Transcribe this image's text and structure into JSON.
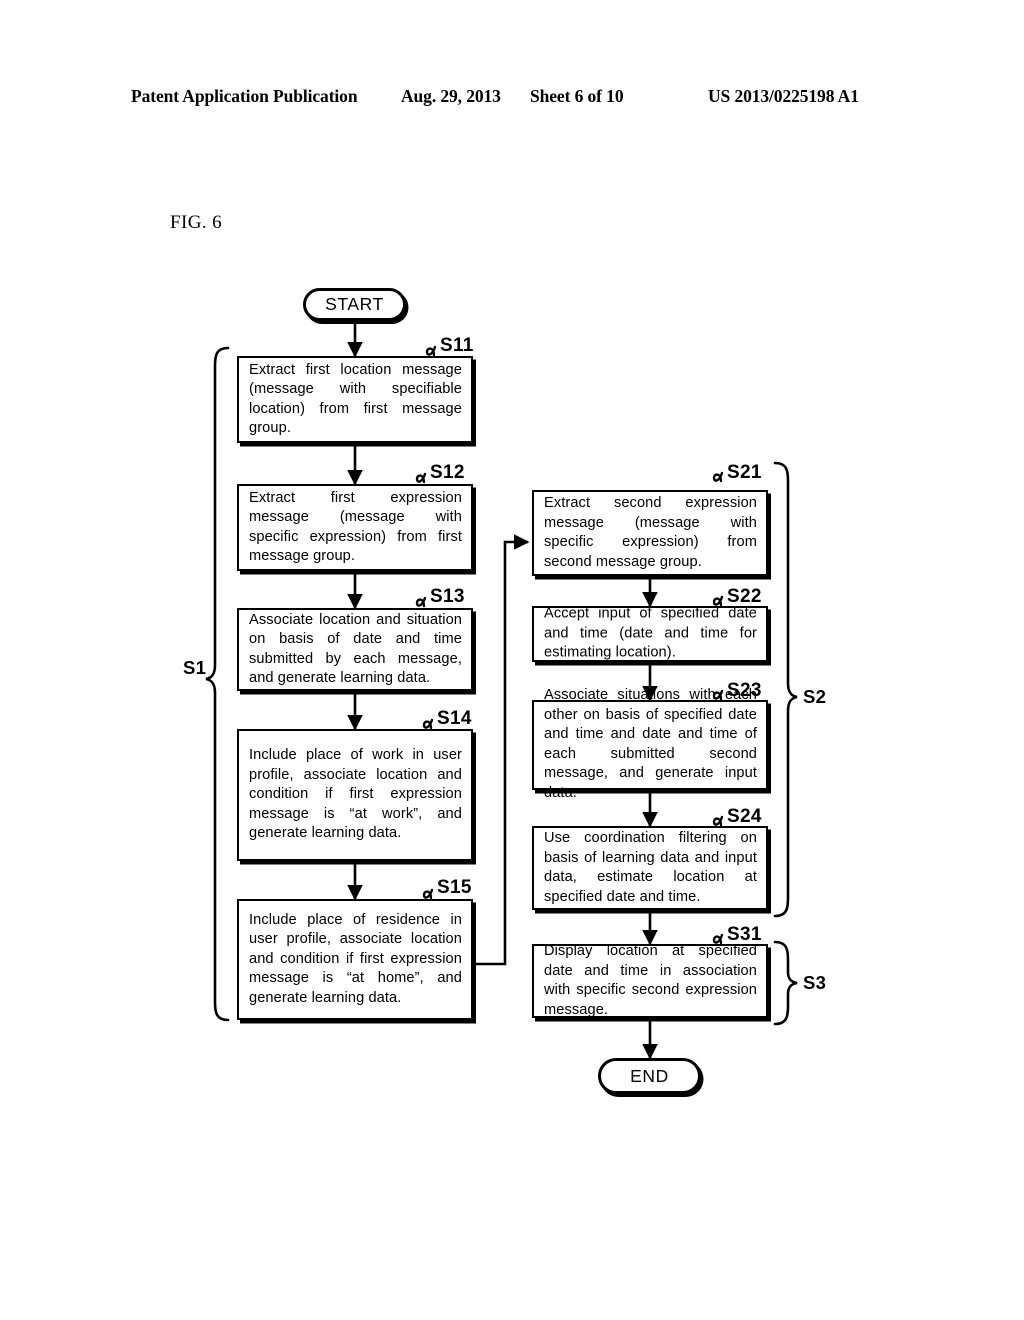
{
  "header": {
    "publication": "Patent Application Publication",
    "date": "Aug. 29, 2013",
    "sheet": "Sheet 6 of 10",
    "number": "US 2013/0225198 A1"
  },
  "figure": {
    "label": "FIG. 6"
  },
  "terminators": {
    "start": "START",
    "end": "END"
  },
  "steps": [
    {
      "id": "S11",
      "label": "S11",
      "text": "Extract first location message (message with specifiable location) from first message group."
    },
    {
      "id": "S12",
      "label": "S12",
      "text": "Extract first expression message (message with specific expression) from first message group."
    },
    {
      "id": "S13",
      "label": "S13",
      "text": "Associate location and situation on basis of date and time submitted by each message, and generate learning data."
    },
    {
      "id": "S14",
      "label": "S14",
      "text": "Include place of work in user profile, associate location and condition if first expression message is “at work”, and generate learning data."
    },
    {
      "id": "S15",
      "label": "S15",
      "text": "Include place of residence in user profile, associate location and condition if first expression message is “at home”, and generate learning data."
    },
    {
      "id": "S21",
      "label": "S21",
      "text": "Extract second expression message (message with specific expression) from second message group."
    },
    {
      "id": "S22",
      "label": "S22",
      "text": "Accept input of specified date and time (date and time for estimating location)."
    },
    {
      "id": "S23",
      "label": "S23",
      "text": "Associate situations with each other on basis of specified date and time and date and time of each submitted second message, and generate input data."
    },
    {
      "id": "S24",
      "label": "S24",
      "text": "Use coordination filtering on basis of learning data and input data, estimate location at specified date and time."
    },
    {
      "id": "S31",
      "label": "S31",
      "text": "Display location at specified date and time in association with specific second expression message."
    }
  ],
  "groups": [
    {
      "id": "S1",
      "label": "S1"
    },
    {
      "id": "S2",
      "label": "S2"
    },
    {
      "id": "S3",
      "label": "S3"
    }
  ],
  "colors": {
    "ink": "#000000",
    "paper": "#ffffff"
  }
}
